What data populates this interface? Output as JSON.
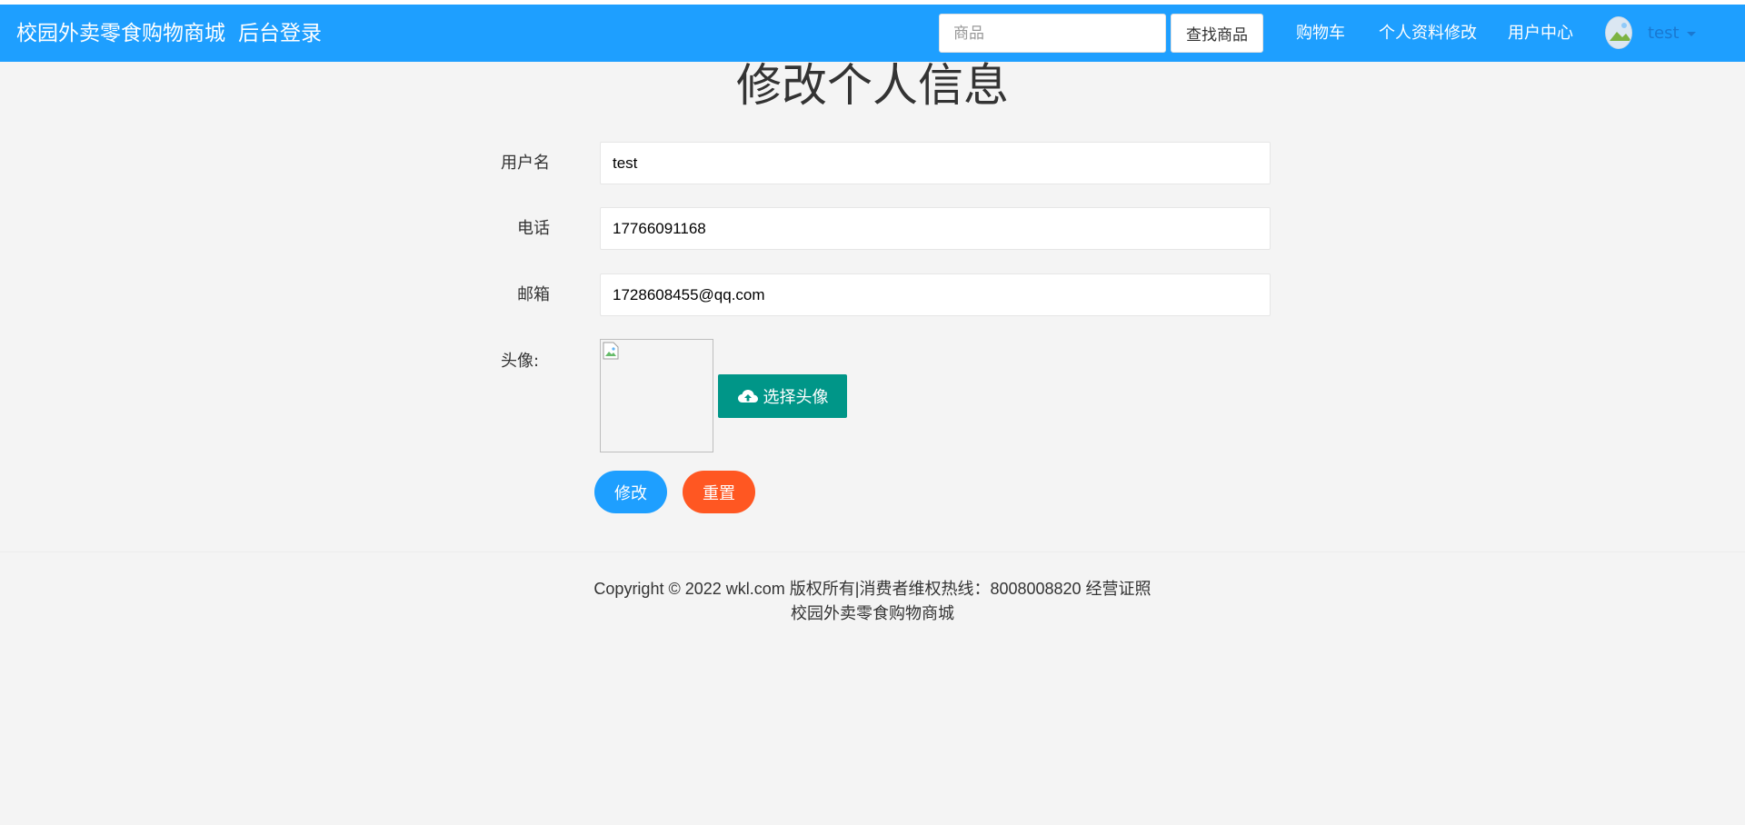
{
  "header": {
    "brand": "校园外卖零食购物商城",
    "admin_login": "后台登录",
    "search": {
      "placeholder": "商品",
      "value": ""
    },
    "search_button": "查找商品",
    "nav": {
      "cart": "购物车",
      "profile_edit": "个人资料修改",
      "user_center": "用户中心"
    },
    "user": {
      "name": "test",
      "avatar_icon": "avatar-icon",
      "menu_icon": "caret-down-icon"
    },
    "colors": {
      "bar": "#1e9fff",
      "text": "#ffffff",
      "username": "#1a78d0"
    }
  },
  "main": {
    "title": "修改个人信息",
    "form": {
      "username_label": "用户名",
      "username_value": "test",
      "phone_label": "电话",
      "phone_value": "17766091168",
      "email_label": "邮箱",
      "email_value": "1728608455@qq.com",
      "avatar_label": "头像:",
      "upload_label": "选择头像",
      "upload_icon": "cloud-upload-icon",
      "submit_label": "修改",
      "reset_label": "重置"
    },
    "colors": {
      "upload": "#009688",
      "submit": "#1e9fff",
      "reset": "#ff5722"
    }
  },
  "footer": {
    "line1": "Copyright © 2022 wkl.com 版权所有|消费者维权热线：8008008820 经营证照",
    "line2": "校园外卖零食购物商城"
  }
}
